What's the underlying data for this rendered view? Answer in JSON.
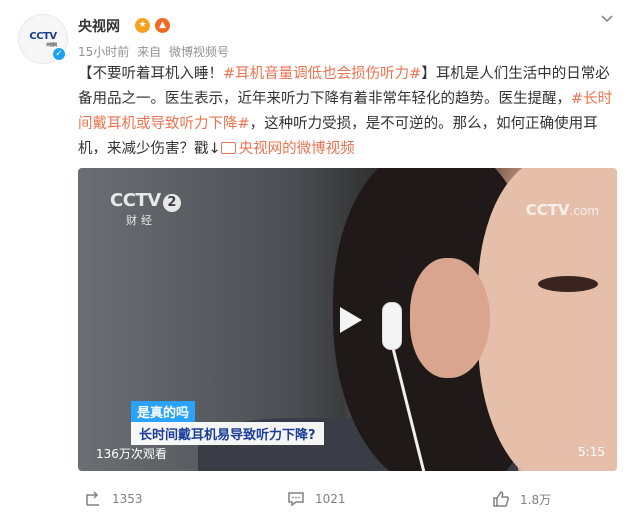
{
  "user": {
    "name": "央视网",
    "time": "15小时前",
    "source_label": "来自",
    "source": "微博视频号",
    "avatar_text": "CCTV",
    "avatar_small": "央视网"
  },
  "post": {
    "bracket_open": "【不要听着耳机入睡！",
    "topic1": "#耳机音量调低也会损伤听力#",
    "bracket_close": "】",
    "text1": "耳机是人们生活中的日常必备用品之一。医生表示，近年来听力下降有着非常年轻化的趋势。医生提醒，",
    "topic2": "#长时间戴耳机或导致听力下降#",
    "text2": "，这种听力受损，是不可逆的。那么，如何正确使用耳机，来减少伤害？戳↓",
    "link_text": "央视网的微博视频"
  },
  "video": {
    "logo_text": "CCTV",
    "logo_number": "2",
    "channel": "财经",
    "watermark": "CCTV",
    "watermark_suffix": ".com",
    "caption_tag": "是真的吗",
    "caption_main": "长时间戴耳机易导致听力下降?",
    "views": "136万次观看",
    "duration": "5:15"
  },
  "actions": {
    "repost_count": "1353",
    "comment_count": "1021",
    "like_count": "1.8万"
  },
  "colors": {
    "topic": "#eb7350",
    "caption_tag_bg": "#2aa2ff",
    "caption_text": "#1b3d9a"
  }
}
